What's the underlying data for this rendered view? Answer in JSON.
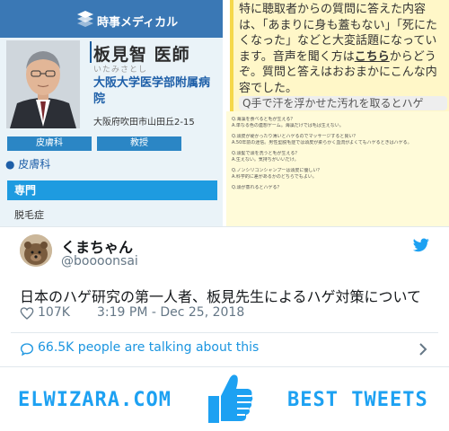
{
  "media": {
    "brand_name": "時事メディカル",
    "doctor_name": "板見智 医師",
    "doctor_reading": "いたみさとし",
    "hospital": "大阪大学医学部附属病院",
    "address": "大阪府吹田市山田丘2-15",
    "pill_dept": "皮膚科",
    "pill_rank": "教授",
    "dept_text": "● 皮膚科",
    "specialty_header": "専門",
    "specialty_text": "脱毛症",
    "qa_intro_before": "特に聴取者からの質問に答えた内容は、「あまりに身も蓋もない」「死にたくなった」などと大変話題になっています。音声を聞く方は",
    "qa_intro_link": "こちら",
    "qa_intro_after": "からどうぞ。質問と答えはおおまかにこんな内容でした。",
    "qa_next": "Q手で汗を浮かせた汚れを取るとハゲ",
    "qa_lines": [
      "Q.海藻を食べると毛が生える？",
      "A.単なる色の連想ゲーム。海藻だけでは毛は生えない。",
      "",
      "Q.頭皮が硬かったり薄いとハゲるのでマッサージすると良い？",
      "A.50年前の迷信。男性型脱毛症では頭皮が柔らかく血流がよくてもハゲるときはハゲる。",
      "",
      "Q.頭髪で頭を洗うと毛が生える？",
      "A.生えない。気持ちがいいだけ。",
      "",
      "Q.ノンシリコンシャンプーは頭皮に優しい？",
      "A.科学的に差があるかのどちらでもよい。",
      "",
      "Q.頭が蒸れるとハゲる？"
    ]
  },
  "tweet": {
    "display_name": "くまちゃん",
    "handle": "@boooonsai",
    "text": "日本のハゲ研究の第一人者、板見先生によるハゲ対策について",
    "like_count": "107K",
    "timestamp": "3:19 PM - Dec 25, 2018",
    "talking_text": "66.5K people are talking about this"
  },
  "banner": {
    "site_name": "ELWIZARA.COM",
    "tagline": "BEST TWEETS"
  },
  "colors": {
    "twitter_blue": "#1da1f2",
    "link_blue": "#1b95e0",
    "brand_blue": "#3a78b5"
  }
}
